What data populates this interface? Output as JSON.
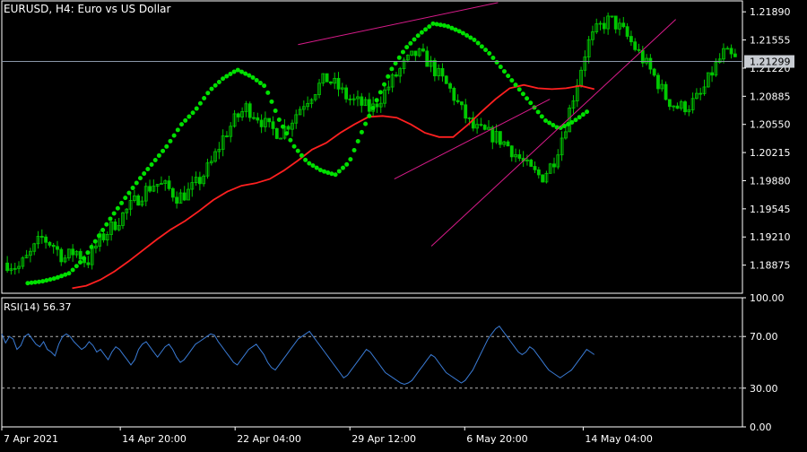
{
  "header": {
    "symbol": "EURUSD",
    "timeframe": "H4",
    "description": "Euro vs US Dollar"
  },
  "colors": {
    "background": "#000000",
    "frame": "#ffffff",
    "candle": "#00c800",
    "sar": "#00e000",
    "moving_average": "#ff2020",
    "channel_lines": "#d81b8a",
    "rsi_line": "#3a7bd5",
    "price_line": "#8a96a8",
    "current_price_box": "#c8ccd2",
    "rsi_levels": "#b0b0b0"
  },
  "chart_data": [
    {
      "type": "candlestick",
      "title": "EURUSD, H4:  Euro vs US Dollar",
      "ylim": [
        1.1854,
        1.2202
      ],
      "y_ticks": [
        "1.21890",
        "1.21555",
        "1.21220",
        "1.20885",
        "1.20550",
        "1.20215",
        "1.19880",
        "1.19545",
        "1.19210",
        "1.18875"
      ],
      "x_ticks": [
        "7 Apr 2021",
        "14 Apr 20:00",
        "22 Apr 04:00",
        "29 Apr 12:00",
        "6 May 20:00",
        "14 May 04:00"
      ],
      "current_price": "1.21299",
      "series": [
        {
          "kind": "close_path",
          "values": [
            1.189,
            1.1885,
            1.19,
            1.192,
            1.1912,
            1.1895,
            1.1905,
            1.189,
            1.1915,
            1.193,
            1.1945,
            1.196,
            1.1975,
            1.1985,
            1.198,
            1.1968,
            1.1975,
            1.199,
            1.201,
            1.204,
            1.206,
            1.2075,
            1.2065,
            1.205,
            1.2045,
            1.206,
            1.208,
            1.2095,
            1.211,
            1.21,
            1.2085,
            1.208,
            1.2072,
            1.209,
            1.211,
            1.2128,
            1.214,
            1.213,
            1.2112,
            1.2095,
            1.207,
            1.205,
            1.2045,
            1.204,
            1.203,
            1.2015,
            1.2,
            1.1992,
            1.201,
            1.205,
            1.21,
            1.215,
            1.217,
            1.218,
            1.2168,
            1.215,
            1.213,
            1.211,
            1.2085,
            1.2075,
            1.2078,
            1.209,
            1.2118,
            1.214,
            1.2132
          ]
        },
        {
          "name": "MA",
          "kind": "moving_average",
          "values": [
            1.186,
            1.1863,
            1.187,
            1.188,
            1.1892,
            1.1905,
            1.1918,
            1.193,
            1.194,
            1.1952,
            1.1965,
            1.1975,
            1.1982,
            1.1985,
            1.199,
            1.2,
            1.2012,
            1.2025,
            1.2033,
            1.2045,
            1.2055,
            1.2064,
            1.2065,
            1.2063,
            1.2055,
            1.2045,
            1.204,
            1.204,
            1.2054,
            1.207,
            1.2085,
            1.2098,
            1.2102,
            1.2098,
            1.2097,
            1.2098,
            1.2101,
            1.2097
          ]
        },
        {
          "name": "Parabolic SAR",
          "kind": "sar",
          "values": [
            1.1866,
            1.1868,
            1.1872,
            1.1878,
            1.1895,
            1.192,
            1.1945,
            1.1968,
            1.199,
            1.201,
            1.203,
            1.2055,
            1.2072,
            1.2095,
            1.211,
            1.212,
            1.2112,
            1.21,
            1.206,
            1.203,
            1.201,
            1.2,
            1.1995,
            1.201,
            1.205,
            1.2085,
            1.212,
            1.2145,
            1.2162,
            1.2175,
            1.2172,
            1.2165,
            1.2155,
            1.214,
            1.212,
            1.21,
            1.208,
            1.206,
            1.205,
            1.2058,
            1.207
          ]
        },
        {
          "name": "channel_lines",
          "kind": "trendlines",
          "upper": [
            [
              0.4,
              1.215
            ],
            [
              0.67,
              1.22
            ]
          ],
          "lower": [
            [
              0.53,
              1.199
            ],
            [
              0.74,
              1.2085
            ]
          ],
          "outer": [
            [
              0.58,
              1.191
            ],
            [
              0.91,
              1.218
            ]
          ]
        }
      ]
    },
    {
      "type": "line",
      "title": "RSI(14) 56.37",
      "ylim": [
        0,
        100
      ],
      "y_ticks": [
        "100.00",
        "70.00",
        "30.00",
        "0.00"
      ],
      "levels": [
        70,
        30
      ],
      "series": [
        {
          "name": "RSI(14)",
          "values": [
            72,
            65,
            70,
            68,
            60,
            63,
            70,
            72,
            68,
            64,
            62,
            66,
            60,
            58,
            55,
            64,
            70,
            72,
            70,
            66,
            63,
            60,
            62,
            66,
            63,
            58,
            60,
            56,
            52,
            58,
            62,
            60,
            56,
            52,
            48,
            52,
            60,
            64,
            66,
            62,
            58,
            54,
            58,
            62,
            64,
            60,
            54,
            50,
            52,
            56,
            60,
            64,
            66,
            68,
            70,
            72,
            71,
            66,
            62,
            58,
            54,
            50,
            48,
            52,
            56,
            60,
            62,
            64,
            60,
            56,
            50,
            46,
            44,
            48,
            52,
            56,
            60,
            64,
            68,
            70,
            72,
            74,
            70,
            66,
            62,
            58,
            54,
            50,
            46,
            42,
            38,
            40,
            44,
            48,
            52,
            56,
            60,
            58,
            54,
            50,
            46,
            42,
            40,
            38,
            36,
            34,
            33,
            34,
            36,
            40,
            44,
            48,
            52,
            56,
            54,
            50,
            46,
            42,
            40,
            38,
            36,
            34,
            36,
            40,
            44,
            50,
            56,
            62,
            68,
            72,
            76,
            78,
            74,
            70,
            66,
            62,
            58,
            56,
            58,
            62,
            60,
            56,
            52,
            48,
            44,
            42,
            40,
            38,
            40,
            42,
            44,
            48,
            52,
            56,
            60,
            58,
            56
          ]
        }
      ]
    }
  ]
}
